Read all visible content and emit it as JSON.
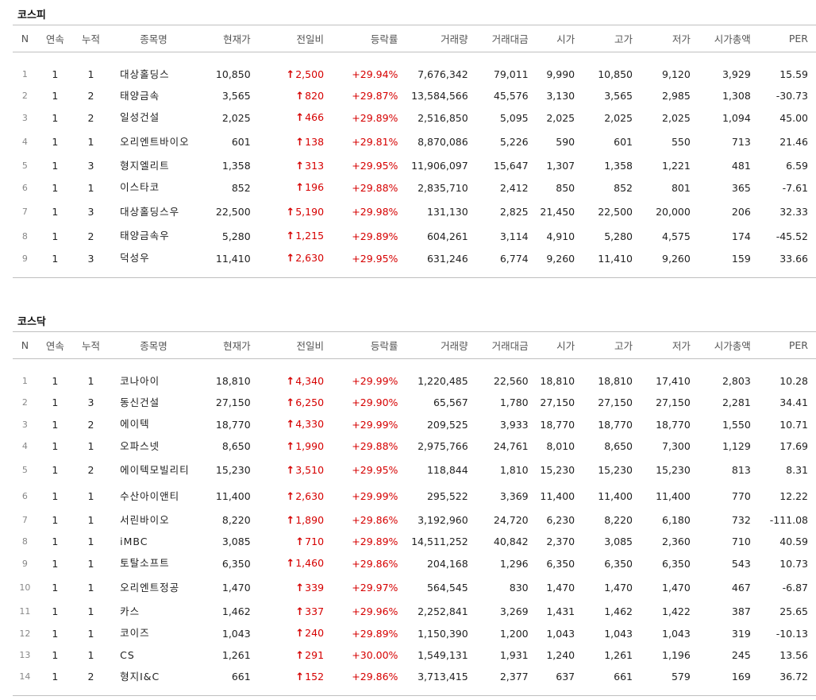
{
  "colors": {
    "up": "#d60000"
  },
  "columns": [
    "N",
    "연속",
    "누적",
    "종목명",
    "현재가",
    "전일비",
    "등락률",
    "거래량",
    "거래대금",
    "시가",
    "고가",
    "저가",
    "시가총액",
    "PER"
  ],
  "sections": [
    {
      "title": "코스피",
      "rows": [
        {
          "n": "1",
          "seq": "1",
          "cum": "1",
          "name": "대상홀딩스",
          "price": "10,850",
          "change": "2,500",
          "rate": "+29.94%",
          "volume": "7,676,342",
          "amount": "79,011",
          "open": "9,990",
          "high": "10,850",
          "low": "9,120",
          "cap": "3,929",
          "per": "15.59"
        },
        {
          "n": "2",
          "seq": "1",
          "cum": "2",
          "name": "태양금속",
          "price": "3,565",
          "change": "820",
          "rate": "+29.87%",
          "volume": "13,584,566",
          "amount": "45,576",
          "open": "3,130",
          "high": "3,565",
          "low": "2,985",
          "cap": "1,308",
          "per": "-30.73"
        },
        {
          "n": "3",
          "seq": "1",
          "cum": "2",
          "name": "일성건설",
          "price": "2,025",
          "change": "466",
          "rate": "+29.89%",
          "volume": "2,516,850",
          "amount": "5,095",
          "open": "2,025",
          "high": "2,025",
          "low": "2,025",
          "cap": "1,094",
          "per": "45.00"
        },
        {
          "n": "4",
          "seq": "1",
          "cum": "1",
          "name": "오리엔트바이오",
          "price": "601",
          "change": "138",
          "rate": "+29.81%",
          "volume": "8,870,086",
          "amount": "5,226",
          "open": "590",
          "high": "601",
          "low": "550",
          "cap": "713",
          "per": "21.46"
        },
        {
          "n": "5",
          "seq": "1",
          "cum": "3",
          "name": "형지엘리트",
          "price": "1,358",
          "change": "313",
          "rate": "+29.95%",
          "volume": "11,906,097",
          "amount": "15,647",
          "open": "1,307",
          "high": "1,358",
          "low": "1,221",
          "cap": "481",
          "per": "6.59"
        },
        {
          "n": "6",
          "seq": "1",
          "cum": "1",
          "name": "이스타코",
          "price": "852",
          "change": "196",
          "rate": "+29.88%",
          "volume": "2,835,710",
          "amount": "2,412",
          "open": "850",
          "high": "852",
          "low": "801",
          "cap": "365",
          "per": "-7.61"
        },
        {
          "n": "7",
          "seq": "1",
          "cum": "3",
          "name": "대상홀딩스우",
          "price": "22,500",
          "change": "5,190",
          "rate": "+29.98%",
          "volume": "131,130",
          "amount": "2,825",
          "open": "21,450",
          "high": "22,500",
          "low": "20,000",
          "cap": "206",
          "per": "32.33"
        },
        {
          "n": "8",
          "seq": "1",
          "cum": "2",
          "name": "태양금속우",
          "price": "5,280",
          "change": "1,215",
          "rate": "+29.89%",
          "volume": "604,261",
          "amount": "3,114",
          "open": "4,910",
          "high": "5,280",
          "low": "4,575",
          "cap": "174",
          "per": "-45.52"
        },
        {
          "n": "9",
          "seq": "1",
          "cum": "3",
          "name": "덕성우",
          "price": "11,410",
          "change": "2,630",
          "rate": "+29.95%",
          "volume": "631,246",
          "amount": "6,774",
          "open": "9,260",
          "high": "11,410",
          "low": "9,260",
          "cap": "159",
          "per": "33.66"
        }
      ]
    },
    {
      "title": "코스닥",
      "rows": [
        {
          "n": "1",
          "seq": "1",
          "cum": "1",
          "name": "코나아이",
          "price": "18,810",
          "change": "4,340",
          "rate": "+29.99%",
          "volume": "1,220,485",
          "amount": "22,560",
          "open": "18,810",
          "high": "18,810",
          "low": "17,410",
          "cap": "2,803",
          "per": "10.28"
        },
        {
          "n": "2",
          "seq": "1",
          "cum": "3",
          "name": "동신건설",
          "price": "27,150",
          "change": "6,250",
          "rate": "+29.90%",
          "volume": "65,567",
          "amount": "1,780",
          "open": "27,150",
          "high": "27,150",
          "low": "27,150",
          "cap": "2,281",
          "per": "34.41"
        },
        {
          "n": "3",
          "seq": "1",
          "cum": "2",
          "name": "에이텍",
          "price": "18,770",
          "change": "4,330",
          "rate": "+29.99%",
          "volume": "209,525",
          "amount": "3,933",
          "open": "18,770",
          "high": "18,770",
          "low": "18,770",
          "cap": "1,550",
          "per": "10.71"
        },
        {
          "n": "4",
          "seq": "1",
          "cum": "1",
          "name": "오파스넷",
          "price": "8,650",
          "change": "1,990",
          "rate": "+29.88%",
          "volume": "2,975,766",
          "amount": "24,761",
          "open": "8,010",
          "high": "8,650",
          "low": "7,300",
          "cap": "1,129",
          "per": "17.69"
        },
        {
          "n": "5",
          "seq": "1",
          "cum": "2",
          "name": "에이텍모빌리티",
          "price": "15,230",
          "change": "3,510",
          "rate": "+29.95%",
          "volume": "118,844",
          "amount": "1,810",
          "open": "15,230",
          "high": "15,230",
          "low": "15,230",
          "cap": "813",
          "per": "8.31"
        },
        {
          "n": "6",
          "seq": "1",
          "cum": "1",
          "name": "수산아이앤티",
          "price": "11,400",
          "change": "2,630",
          "rate": "+29.99%",
          "volume": "295,522",
          "amount": "3,369",
          "open": "11,400",
          "high": "11,400",
          "low": "11,400",
          "cap": "770",
          "per": "12.22"
        },
        {
          "n": "7",
          "seq": "1",
          "cum": "1",
          "name": "서린바이오",
          "price": "8,220",
          "change": "1,890",
          "rate": "+29.86%",
          "volume": "3,192,960",
          "amount": "24,720",
          "open": "6,230",
          "high": "8,220",
          "low": "6,180",
          "cap": "732",
          "per": "-111.08"
        },
        {
          "n": "8",
          "seq": "1",
          "cum": "1",
          "name": "iMBC",
          "price": "3,085",
          "change": "710",
          "rate": "+29.89%",
          "volume": "14,511,252",
          "amount": "40,842",
          "open": "2,370",
          "high": "3,085",
          "low": "2,360",
          "cap": "710",
          "per": "40.59"
        },
        {
          "n": "9",
          "seq": "1",
          "cum": "1",
          "name": "토탈소프트",
          "price": "6,350",
          "change": "1,460",
          "rate": "+29.86%",
          "volume": "204,168",
          "amount": "1,296",
          "open": "6,350",
          "high": "6,350",
          "low": "6,350",
          "cap": "543",
          "per": "10.73"
        },
        {
          "n": "10",
          "seq": "1",
          "cum": "1",
          "name": "오리엔트정공",
          "price": "1,470",
          "change": "339",
          "rate": "+29.97%",
          "volume": "564,545",
          "amount": "830",
          "open": "1,470",
          "high": "1,470",
          "low": "1,470",
          "cap": "467",
          "per": "-6.87"
        },
        {
          "n": "11",
          "seq": "1",
          "cum": "1",
          "name": "카스",
          "price": "1,462",
          "change": "337",
          "rate": "+29.96%",
          "volume": "2,252,841",
          "amount": "3,269",
          "open": "1,431",
          "high": "1,462",
          "low": "1,422",
          "cap": "387",
          "per": "25.65"
        },
        {
          "n": "12",
          "seq": "1",
          "cum": "1",
          "name": "코이즈",
          "price": "1,043",
          "change": "240",
          "rate": "+29.89%",
          "volume": "1,150,390",
          "amount": "1,200",
          "open": "1,043",
          "high": "1,043",
          "low": "1,043",
          "cap": "319",
          "per": "-10.13"
        },
        {
          "n": "13",
          "seq": "1",
          "cum": "1",
          "name": "CS",
          "price": "1,261",
          "change": "291",
          "rate": "+30.00%",
          "volume": "1,549,131",
          "amount": "1,931",
          "open": "1,240",
          "high": "1,261",
          "low": "1,196",
          "cap": "245",
          "per": "13.56"
        },
        {
          "n": "14",
          "seq": "1",
          "cum": "2",
          "name": "형지I&C",
          "price": "661",
          "change": "152",
          "rate": "+29.86%",
          "volume": "3,713,415",
          "amount": "2,377",
          "open": "637",
          "high": "661",
          "low": "579",
          "cap": "169",
          "per": "36.72"
        }
      ]
    }
  ]
}
